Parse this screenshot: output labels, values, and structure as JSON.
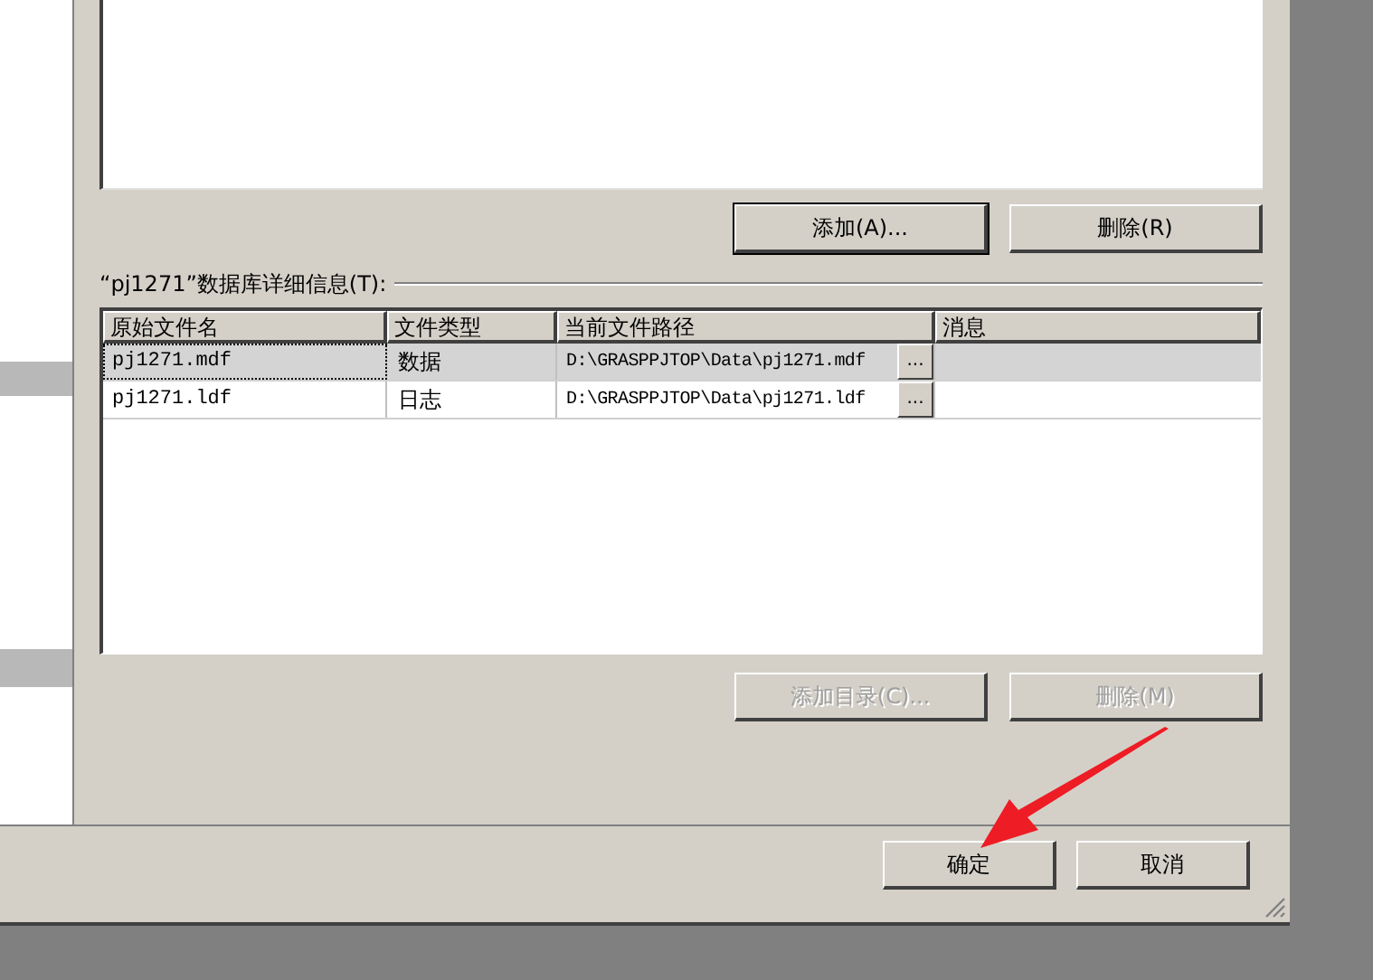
{
  "files_list": {
    "buttons": [
      {
        "label": "添加(A)...",
        "disabled": false,
        "default": true
      },
      {
        "label": "删除(R)",
        "disabled": false,
        "default": false
      }
    ]
  },
  "details": {
    "title": "“pj1271”数据库详细信息(T):",
    "columns": [
      "原始文件名",
      "文件类型",
      "当前文件路径",
      "消息"
    ],
    "rows": [
      {
        "name": "pj1271.mdf",
        "type": "数据",
        "path": "D:\\GRASPPJTOP\\Data\\pj1271.mdf",
        "browse": "...",
        "selected": true
      },
      {
        "name": "pj1271.ldf",
        "type": "日志",
        "path": "D:\\GRASPPJTOP\\Data\\pj1271.ldf",
        "browse": "...",
        "selected": false
      }
    ],
    "buttons": [
      {
        "label": "添加目录(C)...",
        "disabled": true,
        "default": false
      },
      {
        "label": "删除(M)",
        "disabled": true,
        "default": false
      }
    ]
  },
  "footer": {
    "buttons": [
      {
        "label": "确定",
        "disabled": false,
        "default": false
      },
      {
        "label": "取消",
        "disabled": false,
        "default": false
      }
    ]
  }
}
